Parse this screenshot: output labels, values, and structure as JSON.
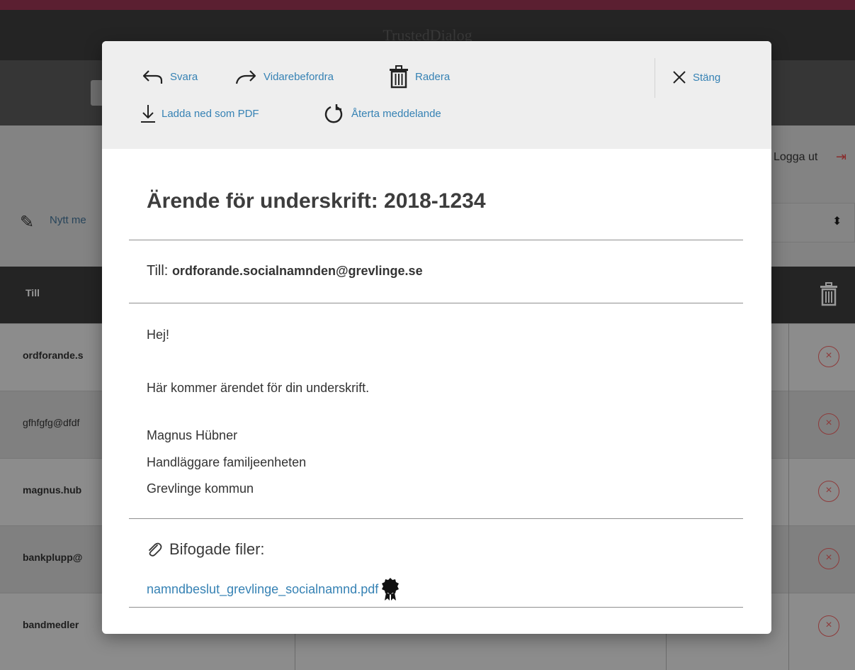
{
  "background": {
    "app_title": "TrustedDialog",
    "logout_label": "Logga ut",
    "new_message_label": "Nytt me",
    "table_header_to": "Till",
    "rows": [
      {
        "to": "ordforande.s"
      },
      {
        "to": "gfhfgfg@dfdf"
      },
      {
        "to": "magnus.hub"
      },
      {
        "to": "bankplupp@"
      },
      {
        "to": "bandmedler"
      }
    ]
  },
  "modal": {
    "toolbar": {
      "reply_label": "Svara",
      "forward_label": "Vidarebefordra",
      "delete_label": "Radera",
      "close_label": "Stäng",
      "download_pdf_label": "Ladda ned som PDF",
      "recall_label": "Återta meddelande"
    },
    "subject": "Ärende för underskrift: 2018-1234",
    "to_label": "Till:",
    "to_address": "ordforande.socialnamnden@grevlinge.se",
    "body": {
      "greeting": "Hej!",
      "line1": "Här kommer ärendet för din underskrift.",
      "signature_name": "Magnus Hübner",
      "signature_title": "Handläggare familjeenheten",
      "signature_org": "Grevlinge kommun"
    },
    "attachments_label": "Bifogade filer:",
    "attachment_file": "namndbeslut_grevlinge_socialnamnd.pdf"
  },
  "icons": {
    "reply": "reply-arrow-icon",
    "forward": "forward-arrow-icon",
    "delete": "trash-icon",
    "close": "close-x-icon",
    "download": "download-arrow-icon",
    "recall": "recall-circular-arrow-icon",
    "attachment": "paperclip-icon",
    "signed": "seal-badge-icon"
  },
  "colors": {
    "link": "#3682b4",
    "toolbar_bg": "#eeeeee",
    "heading": "#3d3d3d"
  }
}
